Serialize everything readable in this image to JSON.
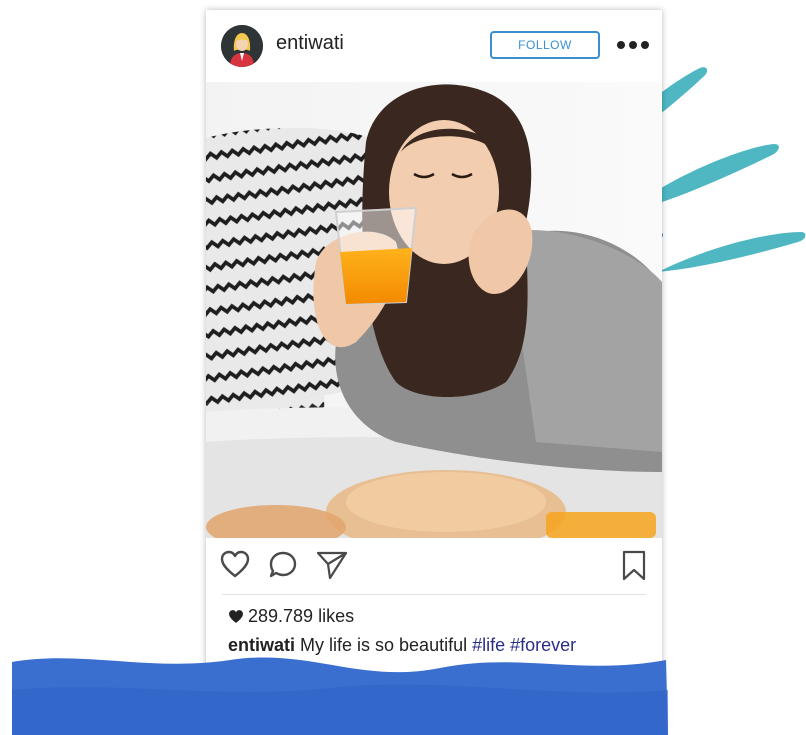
{
  "post": {
    "username": "entiwati",
    "follow_label": "FOLLOW",
    "likes": "289.789 likes",
    "caption": {
      "user": "entiwati",
      "text": " My life is so beautiful ",
      "hashtags": [
        "#life",
        "#forever"
      ]
    }
  },
  "icons": {
    "more": "more-options-icon",
    "like": "heart-outline-icon",
    "comment": "comment-bubble-icon",
    "share": "paper-plane-icon",
    "save": "bookmark-icon",
    "likes_heart": "heart-filled-icon"
  },
  "colors": {
    "accent": "#3a8fd0",
    "hashtag": "#2a2f86",
    "wave": "#3a6fd0",
    "splash_teal": "#4fb7c2",
    "splash_blue": "#1d79b4"
  }
}
